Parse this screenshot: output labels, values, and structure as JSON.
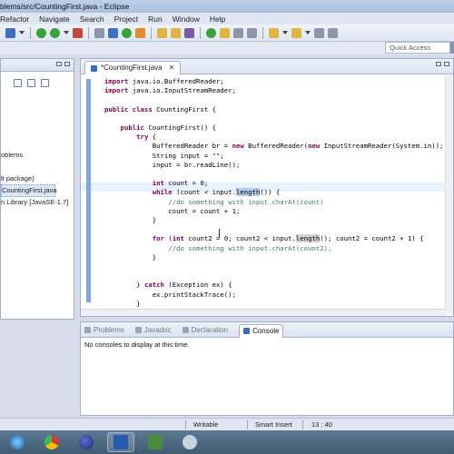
{
  "window": {
    "title": "blems/src/CountingFirst.java - Eclipse"
  },
  "menu": [
    "Refactor",
    "Navigate",
    "Search",
    "Project",
    "Run",
    "Window",
    "Help"
  ],
  "quick_access": {
    "placeholder": "Quick Access"
  },
  "package_explorer": {
    "items": [
      "oblems",
      "lt package)",
      "CountingFirst.java",
      "n Library [JavaSE-1.7]"
    ],
    "selected_index": 2
  },
  "editor": {
    "tab_label": "*CountingFirst.java",
    "tab_close": "✕",
    "lines": [
      {
        "t": [
          [
            "kw",
            "import"
          ],
          [
            "",
            "java.io.BufferedReader;"
          ]
        ]
      },
      {
        "t": [
          [
            "kw",
            "import"
          ],
          [
            "",
            "java.io.InputStreamReader;"
          ]
        ]
      },
      {
        "t": [
          [
            "",
            ""
          ]
        ]
      },
      {
        "t": [
          [
            "kw",
            "public class"
          ],
          [
            "",
            "CountingFirst {"
          ]
        ]
      },
      {
        "t": [
          [
            "",
            ""
          ]
        ]
      },
      {
        "t": [
          [
            "",
            "    "
          ],
          [
            "kw",
            "public"
          ],
          [
            "",
            "CountingFirst() {"
          ]
        ]
      },
      {
        "t": [
          [
            "",
            "        "
          ],
          [
            "kw",
            "try"
          ],
          [
            "",
            "{"
          ]
        ]
      },
      {
        "t": [
          [
            "",
            "            BufferedReader br = "
          ],
          [
            "kw",
            "new"
          ],
          [
            "",
            "BufferedReader("
          ],
          [
            "kw",
            "new"
          ],
          [
            "",
            "InputStreamReader(System."
          ],
          [
            "",
            "in));"
          ]
        ]
      },
      {
        "t": [
          [
            "",
            "            String input = "
          ],
          [
            "str",
            "\"\""
          ],
          [
            "",
            ";"
          ]
        ]
      },
      {
        "t": [
          [
            "",
            "            input = br.readLine();"
          ]
        ]
      },
      {
        "t": [
          [
            "",
            ""
          ]
        ]
      },
      {
        "t": [
          [
            "",
            "            "
          ],
          [
            "kw",
            "int"
          ],
          [
            "",
            "count = 0;"
          ]
        ]
      },
      {
        "t": [
          [
            "",
            "            "
          ],
          [
            "kw",
            "while"
          ],
          [
            "",
            "(count < input."
          ],
          [
            "hl",
            "length"
          ],
          [
            "",
            "()) {"
          ]
        ]
      },
      {
        "t": [
          [
            "",
            "                "
          ],
          [
            "cm",
            "//do something with input.charAt(count)"
          ]
        ]
      },
      {
        "t": [
          [
            "",
            "                count = count + 1;"
          ]
        ]
      },
      {
        "t": [
          [
            "",
            "            }"
          ]
        ]
      },
      {
        "t": [
          [
            "",
            ""
          ]
        ]
      },
      {
        "t": [
          [
            "",
            "            "
          ],
          [
            "kw",
            "for"
          ],
          [
            "",
            "("
          ],
          [
            "kw",
            "int"
          ],
          [
            "",
            "count2 = 0; count2 < input."
          ],
          [
            "occ",
            "length"
          ],
          [
            "",
            "(); count2 = count2 + 1) {"
          ]
        ]
      },
      {
        "t": [
          [
            "",
            "                "
          ],
          [
            "cm",
            "//do something with input.charAt(count2);"
          ]
        ]
      },
      {
        "t": [
          [
            "",
            "            }"
          ]
        ]
      },
      {
        "t": [
          [
            "",
            ""
          ]
        ]
      },
      {
        "t": [
          [
            "",
            ""
          ]
        ]
      },
      {
        "t": [
          [
            "",
            "        } "
          ],
          [
            "kw",
            "catch"
          ],
          [
            "",
            "(Exception ex) {"
          ]
        ]
      },
      {
        "t": [
          [
            "",
            "            ex.printStackTrace();"
          ]
        ]
      },
      {
        "t": [
          [
            "",
            "        }"
          ]
        ]
      },
      {
        "t": [
          [
            "",
            "    }"
          ]
        ]
      }
    ]
  },
  "console": {
    "tabs": [
      "Problems",
      "Javadoc",
      "Declaration",
      "Console"
    ],
    "active_tab": "Console",
    "message": "No consoles to display at this time."
  },
  "status_bar": {
    "mode": "Writable",
    "insert": "Smart Insert",
    "position": "13 : 40"
  },
  "taskbar": {
    "apps": [
      "start-icon",
      "chrome-icon",
      "eclipse-icon",
      "word-icon",
      "game-icon",
      "tool-icon"
    ]
  },
  "colors": {
    "keyword": "#7f0055",
    "string": "#2a00ff",
    "comment": "#3f7f5f",
    "selection": "#b6cbe8"
  }
}
